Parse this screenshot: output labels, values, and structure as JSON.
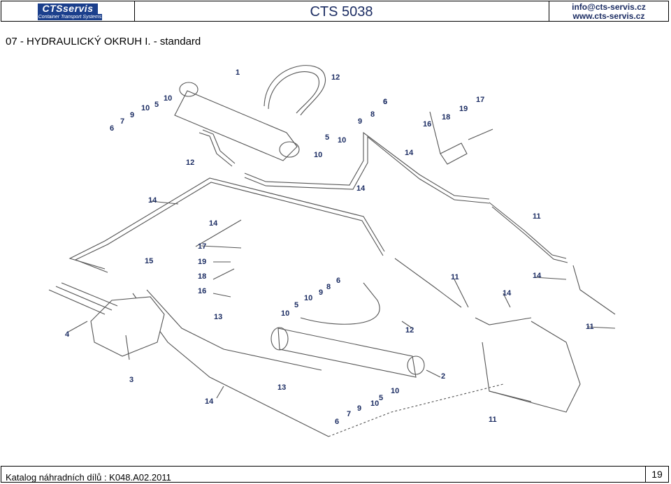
{
  "header": {
    "logo_text": "CTSservis",
    "logo_tagline": "Container Transport Systems",
    "model": "CTS 5038",
    "email": "info@cts-servis.cz",
    "web": "www.cts-servis.cz"
  },
  "section_title": "07 - HYDRAULICKÝ  OKRUH  I. - standard",
  "footer": {
    "catalog": "Katalog náhradních dílů : K048.A02.2011",
    "page": "19"
  },
  "callouts": [
    "1",
    "12",
    "6",
    "10",
    "5",
    "10",
    "9",
    "7",
    "6",
    "12",
    "9",
    "8",
    "6",
    "10",
    "5",
    "10",
    "14",
    "16",
    "18",
    "19",
    "17",
    "14",
    "14",
    "14",
    "11",
    "17",
    "15",
    "19",
    "18",
    "16",
    "13",
    "4",
    "9",
    "8",
    "6",
    "10",
    "5",
    "10",
    "11",
    "14",
    "14",
    "12",
    "11",
    "3",
    "14",
    "13",
    "2",
    "10",
    "5",
    "10",
    "9",
    "7",
    "6",
    "11"
  ],
  "colors": {
    "brand": "#1b3f8c",
    "label": "#1c2d63",
    "line": "#555555"
  }
}
